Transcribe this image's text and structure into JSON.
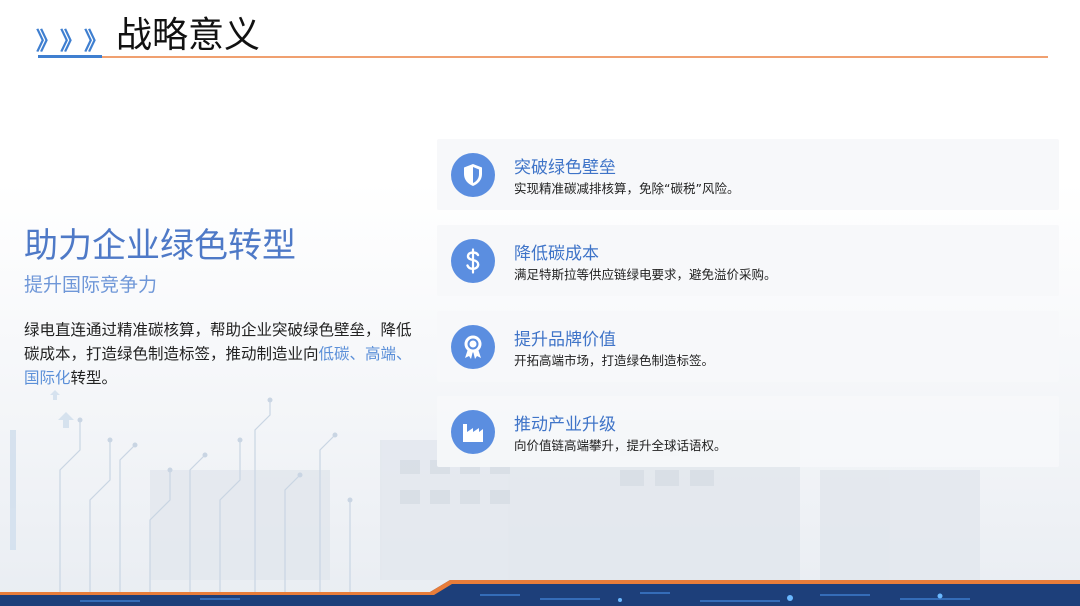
{
  "header": {
    "chevrons": [
      "》",
      "》",
      "》"
    ],
    "title": "战略意义"
  },
  "left": {
    "title": "助力企业绿色转型",
    "subtitle": "提升国际竞争力",
    "desc_before": "绿电直连通过精准碳核算，帮助企业突破绿色壁垒，降低碳成本，打造绿色制造标签，推动制造业向",
    "desc_highlight": "低碳、高端、国际化",
    "desc_after": "转型。"
  },
  "cards": [
    {
      "icon": "shield-icon",
      "title": "突破绿色壁垒",
      "text": "实现精准碳减排核算，免除“碳税”风险。"
    },
    {
      "icon": "dollar-icon",
      "title": "降低碳成本",
      "text": "满足特斯拉等供应链绿电要求，避免溢价采购。"
    },
    {
      "icon": "award-icon",
      "title": "提升品牌价值",
      "text": "开拓高端市场，打造绿色制造标签。"
    },
    {
      "icon": "factory-icon",
      "title": "推动产业升级",
      "text": "向价值链高端攀升，提升全球话语权。"
    }
  ],
  "colors": {
    "accent_blue": "#3f7fd0",
    "icon_blue": "#5b8ee0",
    "title_blue": "#4e79c7",
    "accent_orange": "#f0a070",
    "bottom_navy": "#1d3f7a"
  }
}
